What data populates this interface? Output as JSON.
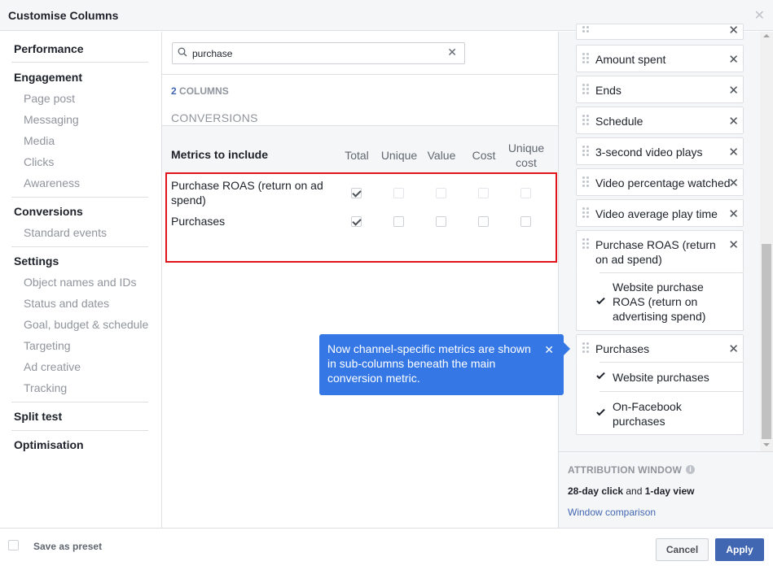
{
  "dialog": {
    "title": "Customise Columns",
    "close_icon": "close-icon"
  },
  "nav": {
    "groups": [
      {
        "title": "Performance",
        "items": []
      },
      {
        "title": "Engagement",
        "items": [
          "Page post",
          "Messaging",
          "Media",
          "Clicks",
          "Awareness"
        ]
      },
      {
        "title": "Conversions",
        "items": [
          "Standard events"
        ]
      },
      {
        "title": "Settings",
        "items": [
          "Object names and IDs",
          "Status and dates",
          "Goal, budget & schedule",
          "Targeting",
          "Ad creative",
          "Tracking"
        ]
      },
      {
        "title": "Split test",
        "items": []
      },
      {
        "title": "Optimisation",
        "items": []
      }
    ]
  },
  "search": {
    "value": "purchase",
    "icon": "search-icon",
    "clear": "✕"
  },
  "results": {
    "count_num": "2",
    "count_label": "COLUMNS",
    "section": "CONVERSIONS",
    "metrics_header": "Metrics to include",
    "columns": [
      "Total",
      "Unique",
      "Value",
      "Cost",
      "Unique cost"
    ],
    "rows": [
      {
        "label": "Purchase ROAS (return on ad spend)",
        "checks": [
          true,
          false,
          false,
          false,
          false
        ]
      },
      {
        "label": "Purchases",
        "checks": [
          true,
          false,
          false,
          false,
          false
        ]
      }
    ]
  },
  "tooltip": {
    "text": "Now channel-specific metrics are shown in sub-columns beneath the main conversion metric.",
    "close": "✕"
  },
  "selected": {
    "items": [
      {
        "label": "Amount spent"
      },
      {
        "label": "Ends"
      },
      {
        "label": "Schedule"
      },
      {
        "label": "3-second video plays"
      },
      {
        "label": "Video percentage watched"
      },
      {
        "label": "Video average play time"
      },
      {
        "label": "Purchase ROAS (return on ad spend)",
        "subs": [
          "Website purchase ROAS (return on advertising spend)"
        ]
      },
      {
        "label": "Purchases",
        "subs": [
          "Website purchases",
          "On-Facebook purchases"
        ]
      }
    ]
  },
  "attribution": {
    "title": "ATTRIBUTION WINDOW",
    "click": "28-day click",
    "and": " and ",
    "view": "1-day view",
    "link": "Window comparison"
  },
  "footer": {
    "preset_label": "Save as preset",
    "cancel": "Cancel",
    "apply": "Apply"
  },
  "colors": {
    "accent": "#4267b2",
    "tooltip": "#3578e5",
    "highlight": "#e0141b"
  }
}
